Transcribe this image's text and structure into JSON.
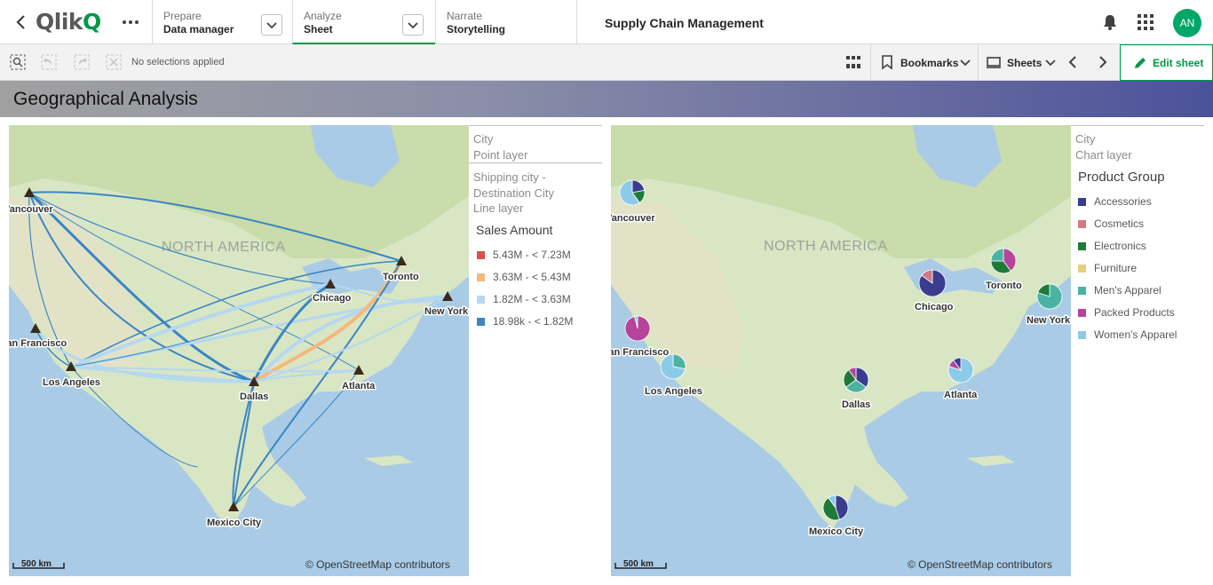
{
  "nav": {
    "prepare": {
      "label": "Prepare",
      "value": "Data manager"
    },
    "analyze": {
      "label": "Analyze",
      "value": "Sheet"
    },
    "narrate": {
      "label": "Narrate",
      "value": "Storytelling"
    },
    "app_title": "Supply Chain Management",
    "avatar": "AN",
    "accent": "#009845"
  },
  "toolbar": {
    "selections": "No selections applied",
    "bookmarks": "Bookmarks",
    "sheets": "Sheets",
    "edit": "Edit sheet"
  },
  "sheet": {
    "title": "Geographical Analysis"
  },
  "map_left": {
    "continent": "NORTH AMERICA",
    "scale": "500 km",
    "attribution": "© OpenStreetMap contributors",
    "cities": [
      "Vancouver",
      "San Francisco",
      "Los Angeles",
      "Dallas",
      "Mexico City",
      "Chicago",
      "Toronto",
      "New York",
      "Atlanta"
    ],
    "legend": {
      "point_layer": {
        "field": "City",
        "layer": "Point layer"
      },
      "line_layer": {
        "field": "Shipping city - Destination City",
        "layer": "Line layer"
      },
      "title": "Sales Amount",
      "items": [
        {
          "label": "5.43M - < 7.23M",
          "color": "#d9534a"
        },
        {
          "label": "3.63M - < 5.43M",
          "color": "#f5b87b"
        },
        {
          "label": "1.82M - < 3.63M",
          "color": "#b5d8f0"
        },
        {
          "label": "18.98k - < 1.82M",
          "color": "#3a86c4"
        }
      ]
    }
  },
  "map_right": {
    "continent": "NORTH AMERICA",
    "scale": "500 km",
    "attribution": "© OpenStreetMap contributors",
    "cities": [
      "Vancouver",
      "San Francisco",
      "Los Angeles",
      "Dallas",
      "Mexico City",
      "Chicago",
      "Toronto",
      "New York",
      "Atlanta"
    ],
    "legend": {
      "field": "City",
      "layer": "Chart layer",
      "title": "Product Group",
      "items": [
        {
          "label": "Accessories",
          "color": "#3a3d8f"
        },
        {
          "label": "Cosmetics",
          "color": "#d27a82"
        },
        {
          "label": "Electronics",
          "color": "#1e7a3a"
        },
        {
          "label": "Furniture",
          "color": "#e6cf7a"
        },
        {
          "label": "Men's Apparel",
          "color": "#4bb3a3"
        },
        {
          "label": "Packed Products",
          "color": "#b6449a"
        },
        {
          "label": "Women's Apparel",
          "color": "#8ccbe8"
        }
      ]
    }
  }
}
